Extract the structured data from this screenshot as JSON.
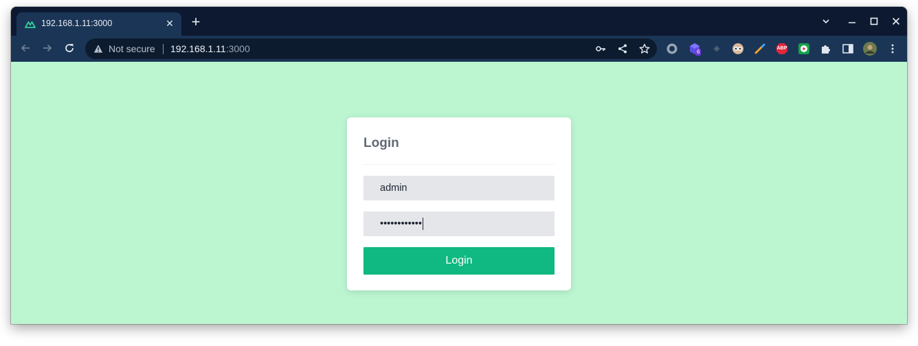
{
  "browser": {
    "tab_title": "192.168.1.11:3000",
    "tab_close_glyph": "✕",
    "new_tab_glyph": "+",
    "window_controls": [
      "⌄",
      "—",
      "☐",
      "✕"
    ],
    "address": {
      "security_text": "Not secure",
      "host": "192.168.1.11",
      "port": ":3000"
    },
    "extension_badge_count": "6",
    "extension_abp_text": "ABP"
  },
  "page": {
    "background_color": "#bbf6d1"
  },
  "login_form": {
    "title": "Login",
    "username_value": "admin",
    "password_value": "••••••••••••",
    "submit_label": "Login",
    "accent_color": "#10b981"
  }
}
